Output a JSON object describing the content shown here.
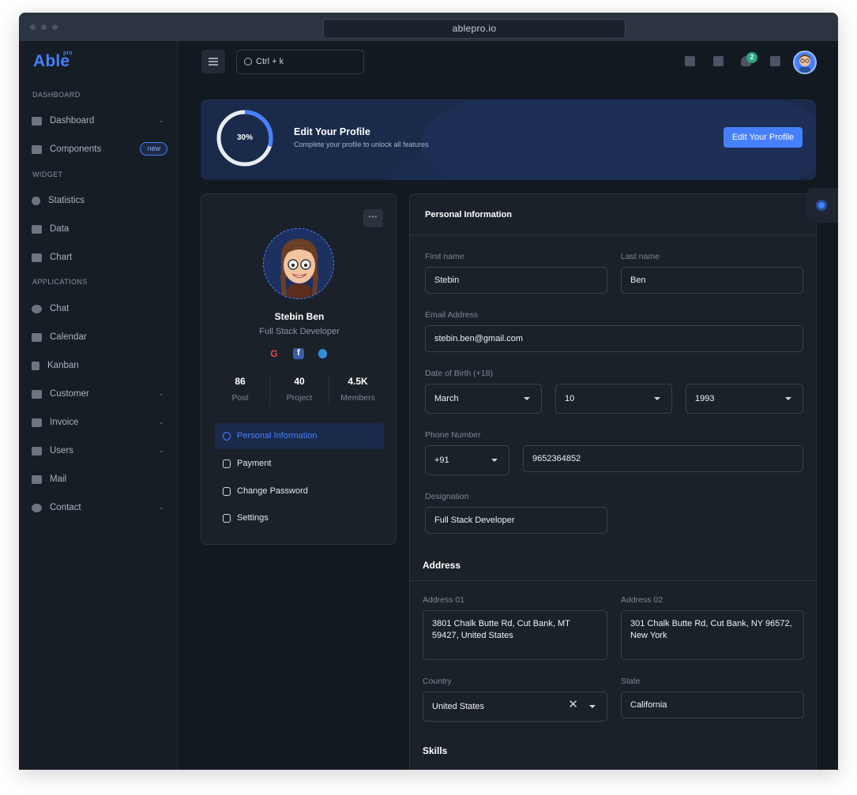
{
  "browser": {
    "url": "ablepro.io"
  },
  "brand": {
    "name": "Able",
    "superscript": "pro"
  },
  "sidebar": {
    "sections": [
      {
        "title": "DASHBOARD"
      },
      {
        "title": "WIDGET"
      },
      {
        "title": "APPLICATIONS"
      }
    ],
    "items": [
      {
        "label": "Dashboard",
        "icon": "dashboard-icon"
      },
      {
        "label": "Components",
        "icon": "components-icon",
        "badge": "new"
      },
      {
        "label": "Statistics",
        "icon": "statistics-icon"
      },
      {
        "label": "Data",
        "icon": "data-icon"
      },
      {
        "label": "Chart",
        "icon": "chart-icon"
      },
      {
        "label": "Chat",
        "icon": "chat-icon"
      },
      {
        "label": "Calendar",
        "icon": "calendar-icon"
      },
      {
        "label": "Kanban",
        "icon": "kanban-icon"
      },
      {
        "label": "Customer",
        "icon": "customer-icon"
      },
      {
        "label": "Invoice",
        "icon": "invoice-icon"
      },
      {
        "label": "Users",
        "icon": "users-icon"
      },
      {
        "label": "Mail",
        "icon": "mail-icon"
      },
      {
        "label": "Contact",
        "icon": "contact-icon"
      }
    ]
  },
  "header": {
    "search_text": "Ctrl + k",
    "notification_count": "2"
  },
  "banner": {
    "progress_label": "30%",
    "progress_value": 0.3,
    "title": "Edit Your Profile",
    "subtitle": "Complete your profile to unlock all features",
    "button": "Edit Your Profile"
  },
  "profile": {
    "more": "•••",
    "name": "Stebin Ben",
    "role": "Full Stack Developer",
    "social": [
      "G",
      "f",
      ""
    ],
    "stats": [
      {
        "value": "86",
        "label": "Post"
      },
      {
        "value": "40",
        "label": "Project"
      },
      {
        "value": "4.5K",
        "label": "Members"
      }
    ],
    "menu": [
      {
        "label": "Personal Information",
        "icon": "user-icon"
      },
      {
        "label": "Payment",
        "icon": "payment-icon"
      },
      {
        "label": "Change Password",
        "icon": "lock-icon"
      },
      {
        "label": "Settings",
        "icon": "settings-icon"
      }
    ]
  },
  "personal": {
    "title": "Personal Information",
    "first_name_label": "First name",
    "first_name": "Stebin",
    "last_name_label": "Last name",
    "last_name": "Ben",
    "email_label": "Email Address",
    "email": "stebin.ben@gmail.com",
    "dob_label": "Date of Birth (+18)",
    "dob_month": "March",
    "dob_day": "10",
    "dob_year": "1993",
    "phone_label": "Phone Number",
    "phone_code": "+91",
    "phone": "9652364852",
    "designation_label": "Designation",
    "designation": "Full Stack Developer"
  },
  "address": {
    "title": "Address",
    "address1_label": "Address 01",
    "address1": "3801 Chalk Butte Rd, Cut Bank, MT 59427, United States",
    "address2_label": "Address 02",
    "address2": "301 Chalk Butte Rd, Cut Bank, NY 96572, New York",
    "country_label": "Country",
    "country": "United States",
    "state_label": "State",
    "state": "California"
  },
  "skills": {
    "title": "Skills"
  },
  "colors": {
    "accent": "#4680ff",
    "success": "#2ca87f",
    "background": "#131920",
    "card": "#1b2129"
  }
}
